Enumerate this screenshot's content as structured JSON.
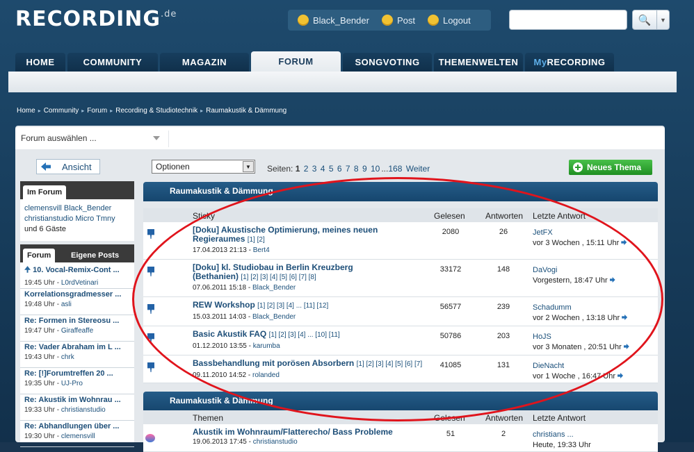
{
  "logo": {
    "text": "RECORDING",
    "suffix": ".de"
  },
  "userbar": {
    "user": "Black_Bender",
    "post": "Post",
    "logout": "Logout"
  },
  "search": {
    "placeholder": "",
    "button_icon": "search-icon"
  },
  "nav": {
    "tabs": [
      {
        "label": "HOME"
      },
      {
        "label": "COMMUNITY"
      },
      {
        "label": "MAGAZIN"
      },
      {
        "label": "FORUM",
        "active": true
      },
      {
        "label": "SONGVOTING"
      },
      {
        "label": "THEMENWELTEN"
      },
      {
        "label_prefix": "My",
        "label": "RECORDING"
      }
    ]
  },
  "breadcrumb": [
    "Home",
    "Community",
    "Forum",
    "Recording & Studiotechnik",
    "Raumakustik & Dämmung"
  ],
  "forum_select": {
    "label": "Forum auswählen ..."
  },
  "sidebar": {
    "back": "Ansicht",
    "im_forum": {
      "title": "Im Forum",
      "users": [
        "clemensvill",
        "Black_Bender",
        "christianstudio",
        "Micro Tmny"
      ],
      "und": "und",
      "guests": "6 Gäste"
    },
    "tabs": {
      "forum": "Forum",
      "eigene": "Eigene Posts"
    },
    "posts": [
      {
        "title": "10. Vocal-Remix-Cont ...",
        "time": "19:45 Uhr - ",
        "user": "L0rdVetinari",
        "sticky": true
      },
      {
        "title": "Korrelationsgradmesser ...",
        "time": "19:48 Uhr - ",
        "user": "asli"
      },
      {
        "title": "Re: Formen in Stereosu ...",
        "time": "19:47 Uhr - ",
        "user": "Giraffeaffe"
      },
      {
        "title": "Re: Vader Abraham im L ...",
        "time": "19:43 Uhr - ",
        "user": "chrk"
      },
      {
        "title": "Re: [!]Forumtreffen 20 ...",
        "time": "19:35 Uhr - ",
        "user": "UJ-Pro"
      },
      {
        "title": "Re: Akustik im Wohnrau ...",
        "time": "19:33 Uhr - ",
        "user": "christianstudio"
      },
      {
        "title": "Re: Abhandlungen über ...",
        "time": "19:30 Uhr - ",
        "user": "clemensvill"
      }
    ]
  },
  "toolbar": {
    "options": "Optionen",
    "pages_label": "Seiten:",
    "current_page": "1",
    "pages": [
      "2",
      "3",
      "4",
      "5",
      "6",
      "7",
      "8",
      "9",
      "10"
    ],
    "ellipsis": "...",
    "last_page": "168",
    "next": "Weiter",
    "new_thread": "Neues Thema"
  },
  "sticky_section": {
    "title": "Raumakustik & Dämmung",
    "cols": {
      "topic": "Sticky",
      "read": "Gelesen",
      "answers": "Antworten",
      "last": "Letzte Antwort"
    },
    "rows": [
      {
        "title": "[Doku] Akustische Optimierung, meines neuen Regieraumes",
        "pages": "[1] [2]",
        "date": "17.04.2013 21:13 - ",
        "author": "Bert4",
        "read": "2080",
        "answers": "26",
        "last_user": "JetFX",
        "last_time": "vor 3 Wochen , 15:11 Uhr"
      },
      {
        "title": "[Doku] kl. Studiobau in Berlin Kreuzberg (Bethanien)",
        "pages": "[1] [2] [3] [4] [5] [6] [7] [8]",
        "date": "07.06.2011 15:18 - ",
        "author": "Black_Bender",
        "read": "33172",
        "answers": "148",
        "last_user": "DaVogi",
        "last_time": "Vorgestern, 18:47 Uhr"
      },
      {
        "title": "REW Workshop",
        "pages": "[1] [2] [3] [4] ... [11] [12]",
        "date": "15.03.2011 14:03 - ",
        "author": "Black_Bender",
        "read": "56577",
        "answers": "239",
        "last_user": "Schadumm",
        "last_time": "vor 2 Wochen , 13:18 Uhr"
      },
      {
        "title": "Basic Akustik FAQ",
        "pages": "[1] [2] [3] [4] ... [10] [11]",
        "date": "01.12.2010 13:55 - ",
        "author": "karumba",
        "read": "50786",
        "answers": "203",
        "last_user": "HoJS",
        "last_time": "vor 3 Monaten , 20:51 Uhr"
      },
      {
        "title": "Bassbehandlung mit porösen Absorbern",
        "pages": "[1] [2] [3] [4] [5] [6] [7]",
        "date": "09.11.2010 14:52 - ",
        "author": "rolanded",
        "read": "41085",
        "answers": "131",
        "last_user": "DieNacht",
        "last_time": "vor 1 Woche , 16:47 Uhr"
      }
    ]
  },
  "topics_section": {
    "title": "Raumakustik & Dämmung",
    "cols": {
      "topic": "Themen",
      "read": "Gelesen",
      "answers": "Antworten",
      "last": "Letzte Antwort"
    },
    "rows": [
      {
        "title": "Akustik im Wohnraum/Flatterecho/ Bass Probleme",
        "date": "19.06.2013 17:45 - ",
        "author": "christianstudio",
        "read": "51",
        "answers": "2",
        "last_user": "christians ...",
        "last_time": "Heute, 19:33 Uhr"
      }
    ]
  },
  "annotation": {
    "color": "#e0141c"
  }
}
